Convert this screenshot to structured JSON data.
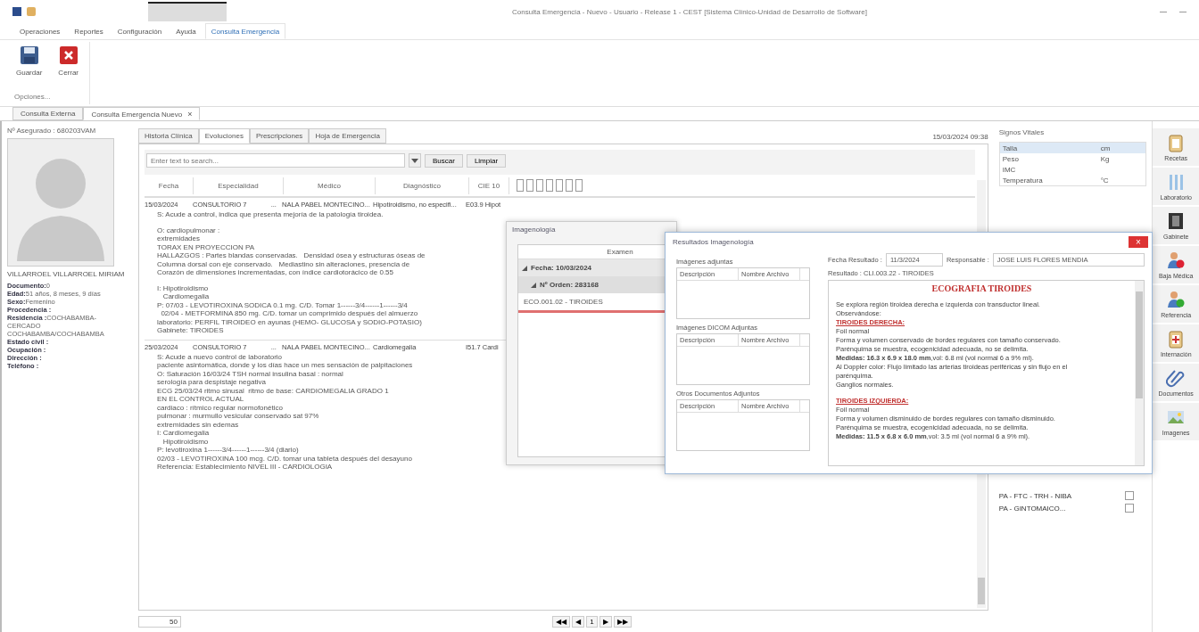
{
  "window": {
    "title": "Consulta Emergencia - Nuevo - Usuario - Release 1 - CEST [Sistema Clínico-Unidad de Desarrollo de Software]"
  },
  "menu": [
    {
      "label": "Operaciones",
      "selected": false
    },
    {
      "label": "Reportes",
      "selected": false
    },
    {
      "label": "Configuración",
      "selected": false
    },
    {
      "label": "Ayuda",
      "selected": false
    },
    {
      "label": "Consulta Emergencia",
      "selected": true
    }
  ],
  "ribbon": {
    "buttons": [
      {
        "kind": "save",
        "label": "Guardar"
      },
      {
        "kind": "close",
        "label": "Cerrar"
      }
    ],
    "group": "Opciones..."
  },
  "doc_tabs": [
    {
      "label": "Consulta Externa",
      "selected": false
    },
    {
      "label": "Consulta Emergencia  Nuevo",
      "selected": true,
      "close": "×"
    }
  ],
  "patient": {
    "insured": "Nº Asegurado : 680203VAM",
    "name": "VILLARROEL VILLARROEL MIRIAM",
    "fields": [
      {
        "label": "Documento:",
        "value": "0"
      },
      {
        "label": "Edad:",
        "value": "51 años, 8 meses, 9 días"
      },
      {
        "label": "Sexo:",
        "value": "Femenino"
      },
      {
        "label": "Procedencia :"
      },
      {
        "label": "Residencia :",
        "value": "COCHABAMBA-CERCADO COCHABAMBA/COCHABAMBA"
      },
      {
        "label": "Estado civil :"
      },
      {
        "label": "Ocupación :"
      },
      {
        "label": "Dirección :"
      },
      {
        "label": "Teléfono :"
      }
    ]
  },
  "tabs": [
    {
      "label": "Historia Clínica",
      "selected": false
    },
    {
      "label": "Evoluciones",
      "selected": true
    },
    {
      "label": "Prescripciones",
      "selected": false
    },
    {
      "label": "Hoja de Emergencia",
      "selected": false
    }
  ],
  "datetime": "15/03/2024 09:38",
  "search": {
    "placeholder": "Enter text to search...",
    "buttons": [
      "Buscar",
      "Limpiar"
    ]
  },
  "table": {
    "columns": [
      "Fecha",
      "Especialidad",
      "Médico",
      "Diagnóstico",
      "CIE 10"
    ],
    "rows": [
      {
        "cells": [
          "15/03/2024",
          "CONSULTORIO 7",
          "NALA PABEL MONTECINO...",
          "Hipotiroidismo, no especifi...",
          "E03.9 Hipot"
        ],
        "more": "...",
        "notes": [
          [
            "S: Acude a control, indica que presenta mejoría de la patología tiroidea."
          ],
          [
            "O: cardiopulmonar :",
            "extremidades",
            "TORAX EN PROYECCION PA",
            "HALLAZGOS : Partes blandas conservadas.   Densidad ósea y estructuras óseas de",
            "Columna dorsal con eje conservado.   Mediastino sin alteraciones, presencia de",
            "Corazón de dimensiones incrementadas, con índice cardiotorácico de 0.55"
          ],
          [
            "I: Hipotiroidismo",
            "   Cardiomegalia",
            "P: 07/03 - LEVOTIROXINA SODICA 0.1 mg. C/D. Tomar 1------3/4------1------3/4",
            "  02/04 - METFORMINA 850 mg. C/D. tomar un comprimido después del almuerzo",
            "laboratorio: PERFIL TIROIDEO en ayunas (HEMO- GLUCOSA y SODIO-POTASIO)",
            "Gabinete: TIROIDES"
          ]
        ]
      },
      {
        "cells": [
          "25/03/2024",
          "CONSULTORIO 7",
          "NALA PABEL MONTECINO...",
          "Cardiomegalia",
          "I51.7 Cardi"
        ],
        "more": "...",
        "notes": [
          [
            "S: Acude a nuevo control de laboratorio",
            "paciente asintomática, donde y los días hace un mes sensación de palpitaciones",
            "O: Saturación 16/03/24 TSH normal insulina basal : normal",
            "serología para despistaje negativa",
            "ECG 25/03/24 ritmo sinusal  ritmo de base: CARDIOMEGALIA GRADO 1",
            "EN EL CONTROL ACTUAL",
            "cardiaco : rítmico regular normofonético",
            "pulmonar : murmullo vesicular conservado sat 97%",
            "extremidades sin edemas",
            "I: Cardiomegalia",
            "   Hipotiroidismo",
            "P: levotiroxina 1------3/4------1------3/4 (diario)",
            "02/03 - LEVOTIROXINA 100 mcg. C/D. tomar una tableta después del desayuno",
            "Referencia: Establecimiento NIVEL III - CARDIOLOGIA"
          ]
        ]
      }
    ]
  },
  "pager": {
    "page_size": "50",
    "buttons": [
      "◀◀",
      "◀",
      "1",
      "▶",
      "▶▶"
    ]
  },
  "vitals": {
    "title": "Signos Vitales",
    "rows": [
      {
        "label": "Talla",
        "unit": "cm",
        "selected": true
      },
      {
        "label": "Peso",
        "unit": "Kg",
        "selected": false
      },
      {
        "label": "IMC",
        "selected": false
      },
      {
        "label": "Temperatura",
        "unit": "°C",
        "selected": false
      }
    ]
  },
  "checks": [
    {
      "label": "PA - FTC - TRH - NIBA",
      "checked": false
    },
    {
      "label": "PA - GINTOMAICO...",
      "checked": false
    }
  ],
  "sidebar": [
    {
      "kind": "clipboard",
      "label": "Recetas"
    },
    {
      "kind": "tubes",
      "label": "Laboratorio"
    },
    {
      "kind": "xray",
      "label": "Gabinete"
    },
    {
      "kind": "person-red",
      "label": "Baja Médica"
    },
    {
      "kind": "person-green",
      "label": "Referencia"
    },
    {
      "kind": "bed",
      "label": "Internación"
    },
    {
      "kind": "clip",
      "label": "Documentos"
    },
    {
      "kind": "picture",
      "label": "Imagenes"
    }
  ],
  "imaging": {
    "title": "Imagenología",
    "column": "Examen",
    "tree": [
      {
        "label": "Fecha: 10/03/2024",
        "children": [
          {
            "label": "Nº Orden: 283168",
            "children": [
              {
                "label": "ECO.001.02 - TIROIDES",
                "selected": true
              }
            ]
          }
        ]
      }
    ]
  },
  "results": {
    "title": "Resultados Imagenología",
    "close": "×",
    "attachments": [
      {
        "title": "Imágenes adjuntas",
        "columns": [
          "Descripción",
          "Nombre Archivo"
        ]
      },
      {
        "title": "Imágenes DICOM Adjuntas",
        "columns": [
          "Descripción",
          "Nombre Archivo"
        ]
      },
      {
        "title": "Otros Documentos Adjuntos",
        "columns": [
          "Descripción",
          "Nombre Archivo"
        ]
      }
    ],
    "date_label": "Fecha Resultado :",
    "date": "11/3/2024",
    "resp_label": "Responsable :",
    "responsible": "JOSE LUIS FLORES MENDIA",
    "result": "Resultado : CLI.003.22 - TIROIDES",
    "report": [
      {
        "kind": "title",
        "text": "ECOGRAFIA TIROIDES"
      },
      {
        "kind": "text",
        "text": "Se explora región tiroidea derecha e izquierda con transductor lineal."
      },
      {
        "kind": "text",
        "text": "Observándose:"
      },
      {
        "kind": "heading",
        "text": "TIROIDES DERECHA:"
      },
      {
        "kind": "text",
        "text": "Foil normal"
      },
      {
        "kind": "text",
        "text": "Forma y volumen conservado de bordes regulares con tamaño conservado."
      },
      {
        "kind": "text",
        "text": "Parénquima se muestra, ecogenicidad adecuada, no se delimita."
      },
      {
        "kind": "text",
        "text": "**Medidas: 16.3 x 6.9 x 18.0 mm**,vol: 6.8 ml (vol normal 6 a 9% ml)."
      },
      {
        "kind": "text",
        "text": "Al Doppler color: Flujo limitado las arterias tiroideas periféricas y sin flujo en el"
      },
      {
        "kind": "text",
        "text": "parénquima."
      },
      {
        "kind": "text",
        "text": "Ganglios normales."
      },
      {
        "kind": "gap"
      },
      {
        "kind": "heading",
        "text": "TIROIDES IZQUIERDA:"
      },
      {
        "kind": "text",
        "text": "Foil normal"
      },
      {
        "kind": "text",
        "text": "Forma y volumen disminuido de bordes regulares con tamaño disminuido."
      },
      {
        "kind": "text",
        "text": "Parénquima se muestra, ecogenicidad adecuada, no se delimita."
      },
      {
        "kind": "text",
        "text": "**Medidas: 11.5 x 6.8 x 6.0 mm**,vol: 3.5 ml (vol normal 6 a 9% ml)."
      }
    ]
  }
}
